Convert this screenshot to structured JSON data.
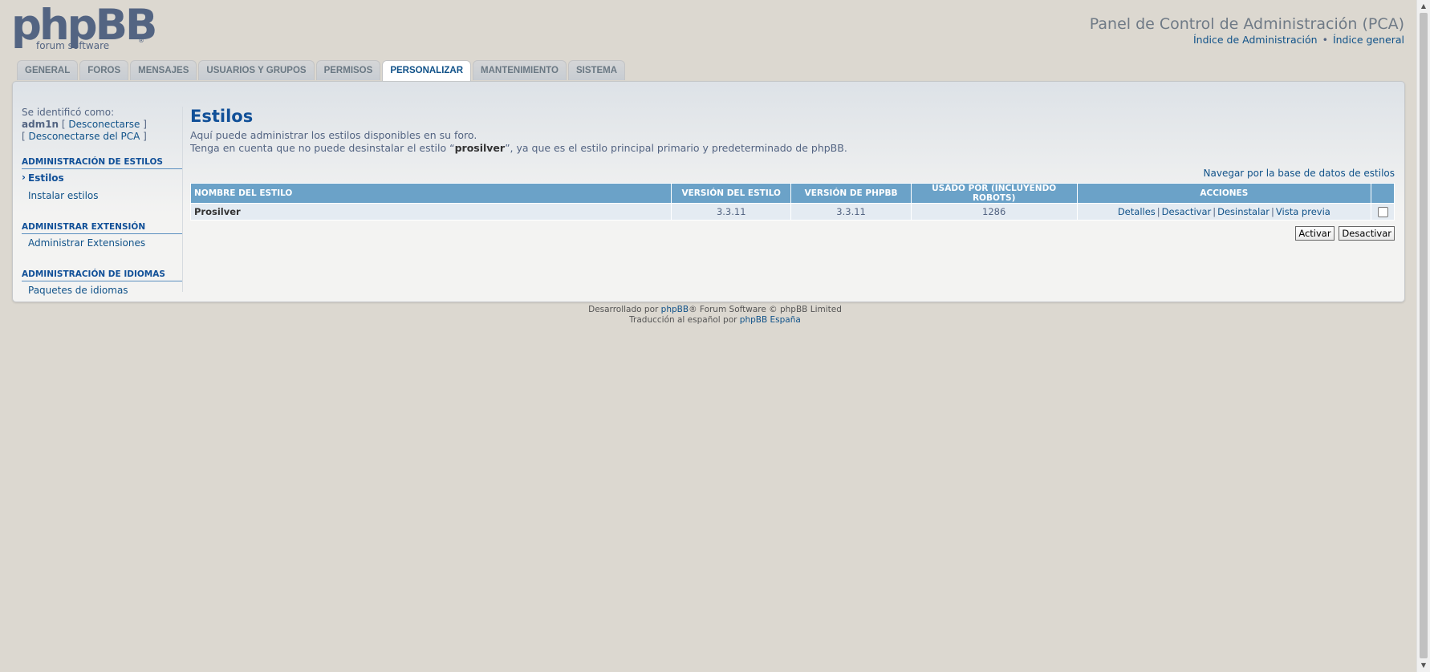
{
  "logo": {
    "main": "phpBB",
    "sub": "forum  software",
    "reg": "®"
  },
  "header": {
    "title": "Panel de Control de Administración (PCA)",
    "links": [
      "Índice de Administración",
      "Índice general"
    ],
    "separator": "•"
  },
  "tabs": [
    "GENERAL",
    "FOROS",
    "MENSAJES",
    "USUARIOS Y GRUPOS",
    "PERMISOS",
    "PERSONALIZAR",
    "MANTENIMIENTO",
    "SISTEMA"
  ],
  "active_tab": "PERSONALIZAR",
  "sidebar": {
    "logged_as": "Se identificó como:",
    "username": "adm1n",
    "logout": "Desconectarse",
    "logout_acp": "Desconectarse del PCA",
    "sections": [
      {
        "header": "ADMINISTRACIÓN DE ESTILOS",
        "items": [
          "Estilos",
          "Instalar estilos"
        ]
      },
      {
        "header": "ADMINISTRAR EXTENSIÓN",
        "items": [
          "Administrar Extensiones"
        ]
      },
      {
        "header": "ADMINISTRACIÓN DE IDIOMAS",
        "items": [
          "Paquetes de idiomas"
        ]
      }
    ]
  },
  "main": {
    "title": "Estilos",
    "desc1": "Aquí puede administrar los estilos disponibles en su foro.",
    "desc2_pre": "Tenga en cuenta que no puede desinstalar el estilo “",
    "desc2_bold": "prosilver",
    "desc2_post": "”, ya que es el estilo principal primario y predeterminado de phpBB.",
    "browse_link": "Navegar por la base de datos de estilos",
    "table": {
      "headers": [
        "NOMBRE DEL ESTILO",
        "VERSIÓN DEL ESTILO",
        "VERSIÓN DE PHPBB",
        "USADO POR (INCLUYENDO ROBOTS)",
        "ACCIONES",
        ""
      ],
      "rows": [
        {
          "name": "Prosilver",
          "style_version": "3.3.11",
          "phpbb_version": "3.3.11",
          "used_by": "1286",
          "actions": [
            "Detalles",
            "Desactivar",
            "Desinstalar",
            "Vista previa"
          ]
        }
      ]
    },
    "buttons": {
      "activate": "Activar",
      "deactivate": "Desactivar"
    }
  },
  "footer": {
    "line1_pre": "Desarrollado por ",
    "line1_link": "phpBB",
    "line1_post": "® Forum Software © phpBB Limited",
    "line2_pre": "Traducción al español por ",
    "line2_link": "phpBB España"
  }
}
